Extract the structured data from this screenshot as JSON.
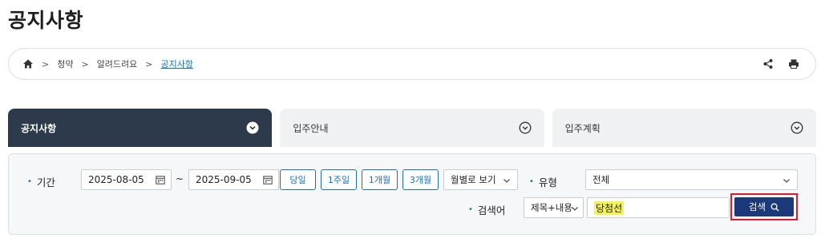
{
  "page": {
    "title": "공지사항"
  },
  "breadcrumb": {
    "home_icon": "home-icon",
    "items": [
      "청약",
      "알려드려요",
      "공지사항"
    ],
    "separator": ">",
    "actions": [
      "share-icon",
      "print-icon"
    ]
  },
  "tabs": [
    {
      "label": "공지사항",
      "active": true
    },
    {
      "label": "입주안내",
      "active": false
    },
    {
      "label": "입주계획",
      "active": false
    }
  ],
  "search": {
    "period_label": "기간",
    "start_date": "2025-08-05",
    "range_sep": "~",
    "end_date": "2025-09-05",
    "quick_buttons": [
      "당일",
      "1주일",
      "1개월",
      "3개월"
    ],
    "monthly_view": "월별로 보기",
    "type_label": "유형",
    "type_value": "전체",
    "keyword_label": "검색어",
    "keyword_scope": "제목+내용",
    "keyword_value": "당첨선",
    "search_button": "검색"
  },
  "colors": {
    "active_tab": "#2d3a4b",
    "accent_blue": "#1a6fb5",
    "search_button": "#1c3a7a",
    "highlight_box": "#e0182b",
    "keyword_highlight": "#f5f35a"
  }
}
